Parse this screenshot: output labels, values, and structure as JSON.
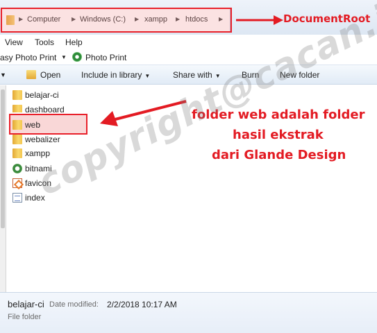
{
  "address_bar": {
    "crumbs": [
      "Computer",
      "Windows (C:)",
      "xampp",
      "htdocs"
    ]
  },
  "annotations": {
    "address_label": "DocumentRoot",
    "folder_note_lines": [
      "folder web adalah folder",
      "hasil ekstrak",
      "dari Glande Design"
    ],
    "highlight_color": "#e8202a"
  },
  "menu": {
    "items": [
      "View",
      "Tools",
      "Help"
    ]
  },
  "subbar": {
    "easy_photo_print": "asy Photo Print",
    "photo_print": "Photo Print"
  },
  "toolbar": {
    "open_label": "Open",
    "include_label": "Include in library",
    "share_label": "Share with",
    "burn_label": "Burn",
    "new_folder_label": "New folder"
  },
  "files": [
    {
      "name": "belajar-ci",
      "icon": "folder-icon"
    },
    {
      "name": "dashboard",
      "icon": "folder-icon"
    },
    {
      "name": "web",
      "icon": "folder-icon"
    },
    {
      "name": "webalizer",
      "icon": "folder-icon"
    },
    {
      "name": "xampp",
      "icon": "folder-icon"
    },
    {
      "name": "bitnami",
      "icon": "bitnami-icon"
    },
    {
      "name": "favicon",
      "icon": "favicon-icon"
    },
    {
      "name": "index",
      "icon": "document-icon"
    }
  ],
  "watermark": "copyright@cacan.id",
  "details": {
    "name": "belajar-ci",
    "modified_label": "Date modified:",
    "modified_value": "2/2/2018 10:17 AM",
    "type": "File folder"
  }
}
